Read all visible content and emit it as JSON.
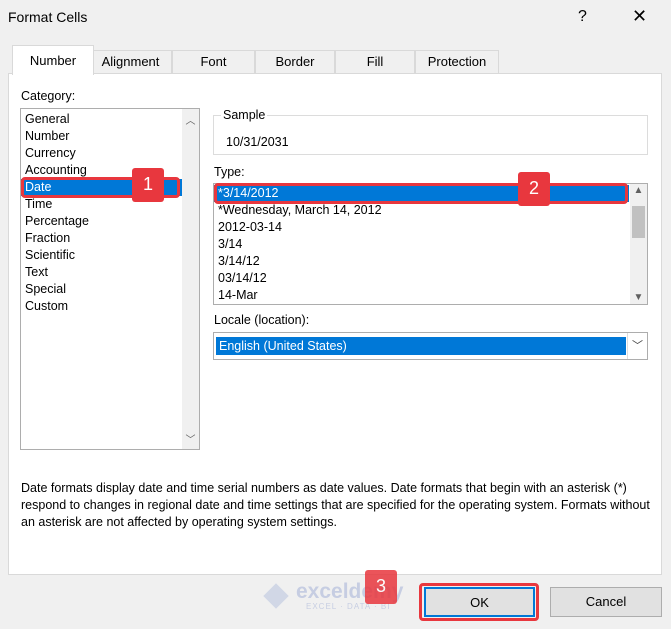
{
  "dialog": {
    "title": "Format Cells",
    "help": "?",
    "close": "✕"
  },
  "tabs": [
    "Number",
    "Alignment",
    "Font",
    "Border",
    "Fill",
    "Protection"
  ],
  "category": {
    "label": "Category:",
    "items": [
      "General",
      "Number",
      "Currency",
      "Accounting",
      "Date",
      "Time",
      "Percentage",
      "Fraction",
      "Scientific",
      "Text",
      "Special",
      "Custom"
    ],
    "selected": "Date"
  },
  "sample": {
    "label": "Sample",
    "value": "10/31/2031"
  },
  "type": {
    "label": "Type:",
    "items": [
      "*3/14/2012",
      "*Wednesday, March 14, 2012",
      "2012-03-14",
      "3/14",
      "3/14/12",
      "03/14/12",
      "14-Mar"
    ],
    "selected": "*3/14/2012"
  },
  "locale": {
    "label": "Locale (location):",
    "value": "English (United States)"
  },
  "description": "Date formats display date and time serial numbers as date values.  Date formats that begin with an asterisk (*) respond to changes in regional date and time settings that are specified for the operating system. Formats without an asterisk are not affected by operating system settings.",
  "buttons": {
    "ok": "OK",
    "cancel": "Cancel"
  },
  "badges": [
    "1",
    "2",
    "3"
  ],
  "watermark": {
    "name": "exceldemy",
    "tagline": "EXCEL · DATA · BI"
  },
  "colors": {
    "accent": "#0078d7",
    "badge": "#e8373e"
  }
}
